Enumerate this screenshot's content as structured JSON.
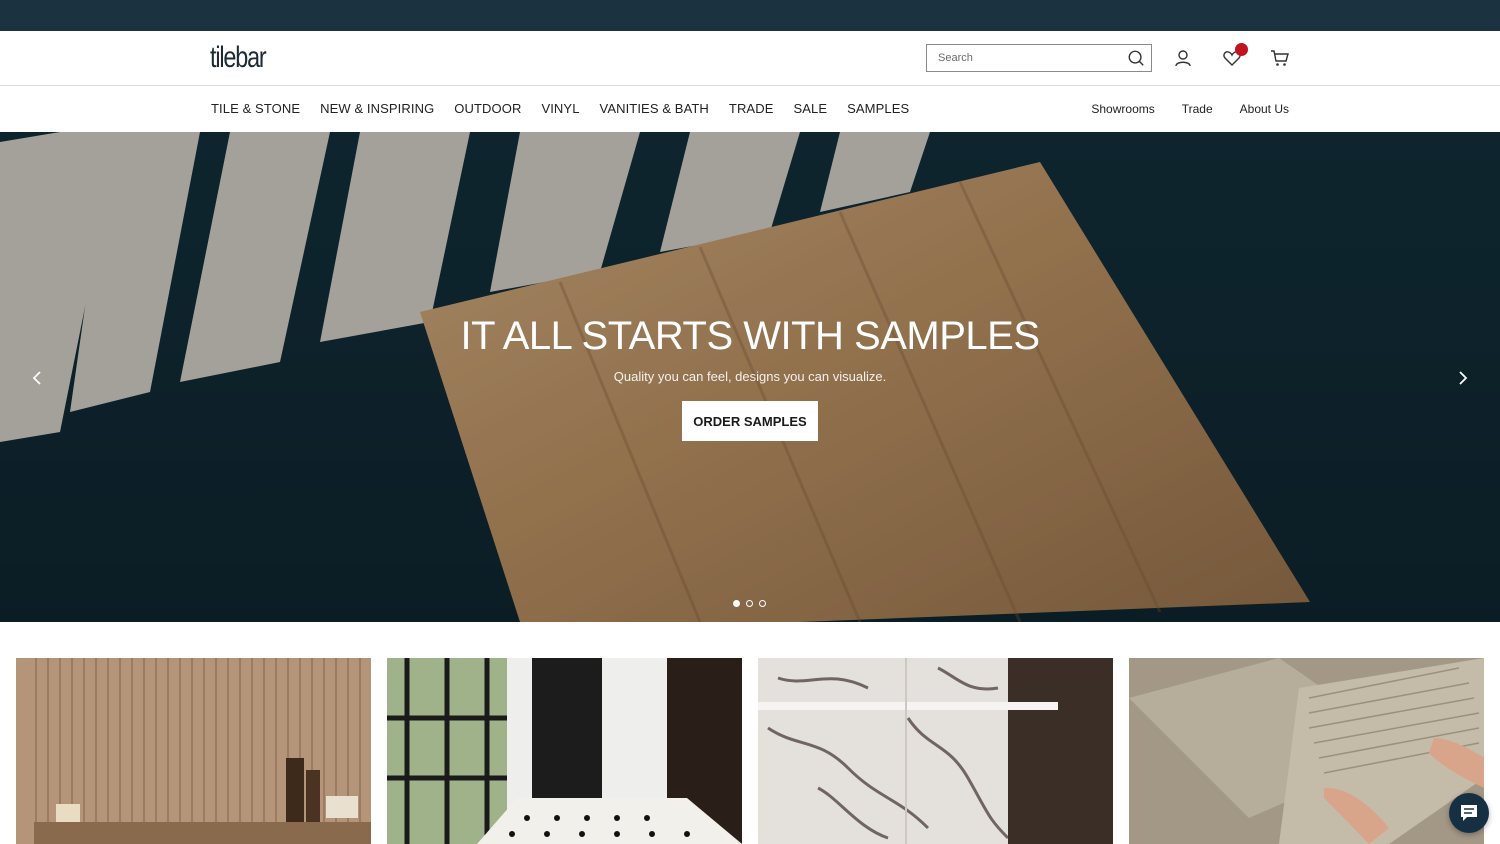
{
  "brand": {
    "logo_text": "tilebar"
  },
  "header": {
    "search_placeholder": "Search",
    "icons": [
      "search-icon",
      "user-icon",
      "heart-icon",
      "cart-icon"
    ],
    "wishlist_badge_color": "#c1121f"
  },
  "nav": {
    "main_items": [
      "TILE & STONE",
      "NEW & INSPIRING",
      "OUTDOOR",
      "VINYL",
      "VANITIES & BATH",
      "TRADE",
      "SALE",
      "SAMPLES"
    ],
    "secondary_items": [
      "Showrooms",
      "Trade",
      "About Us"
    ]
  },
  "hero": {
    "title": "IT ALL STARTS WITH SAMPLES",
    "subtitle": "Quality you can feel, designs you can visualize.",
    "cta_label": "ORDER SAMPLES",
    "slides_total": 3,
    "active_slide": 1
  },
  "colors": {
    "topbar": "#1b3340",
    "hero_bg": "#13303c",
    "chat": "#163043"
  }
}
